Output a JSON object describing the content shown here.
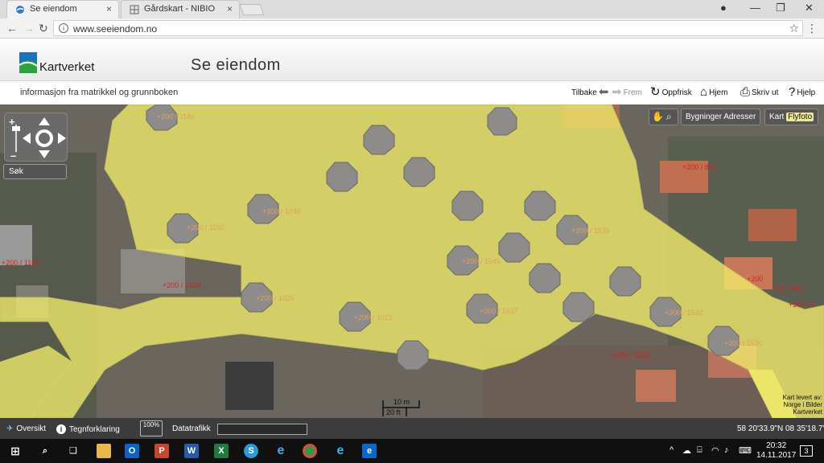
{
  "browser": {
    "tabs": [
      {
        "title": "Se eiendom",
        "close": "×"
      },
      {
        "title": "Gårdskart - NIBIO",
        "close": "×"
      }
    ],
    "url": "www.seeiendom.no"
  },
  "site": {
    "logo_text": "Kartverket",
    "title": "Se eiendom",
    "tagline": "informasjon fra matrikkel og grunnboken"
  },
  "toolbar": {
    "back": "Tilbake",
    "forward": "Frem",
    "refresh": "Oppfrisk",
    "home": "Hjem",
    "print": "Skriv ut",
    "help": "Hjelp"
  },
  "map": {
    "search": "Søk",
    "layers": {
      "buildings": "Bygninger",
      "addresses": "Adresser",
      "map": "Kart",
      "aerial": "Flyfoto"
    },
    "scale": {
      "metric": "10 m",
      "imperial": "20 ft"
    },
    "credit": [
      "Kart levert av:",
      "Norge i Bilder",
      "Kartverket"
    ],
    "parcel_labels": [
      {
        "text": "200 / 1146",
        "faded": true
      },
      {
        "text": "200 / 1150",
        "faded": true
      },
      {
        "text": "200 / 1160",
        "faded": false
      },
      {
        "text": "200 / 1028",
        "faded": false
      },
      {
        "text": "200 / 832",
        "faded": false
      },
      {
        "text": "200 / 1533",
        "faded": false
      },
      {
        "text": "200 / 1530",
        "faded": true
      },
      {
        "text": "200 / 1532",
        "faded": true
      },
      {
        "text": "200 / 1537",
        "faded": true
      },
      {
        "text": "200 / 1545",
        "faded": true
      },
      {
        "text": "200",
        "faded": false
      },
      {
        "text": "200 / 1022",
        "faded": true
      },
      {
        "text": "200 / 1025",
        "faded": true
      },
      {
        "text": "200 / 1040",
        "faded": true
      },
      {
        "text": "200 / 1535",
        "faded": true
      },
      {
        "text": "30 / 584",
        "faded": false
      },
      {
        "text": "200 / 1",
        "faded": false
      }
    ]
  },
  "statusbar": {
    "overview": "Oversikt",
    "legend": "Tegnforklaring",
    "zoom": "100%",
    "traffic": "Datatrafikk",
    "coords": "58 20'33.9\"N 08 35'18.7\"Ø"
  },
  "taskbar": {
    "time": "20:32",
    "date": "14.11.2017",
    "notifications": "3"
  }
}
